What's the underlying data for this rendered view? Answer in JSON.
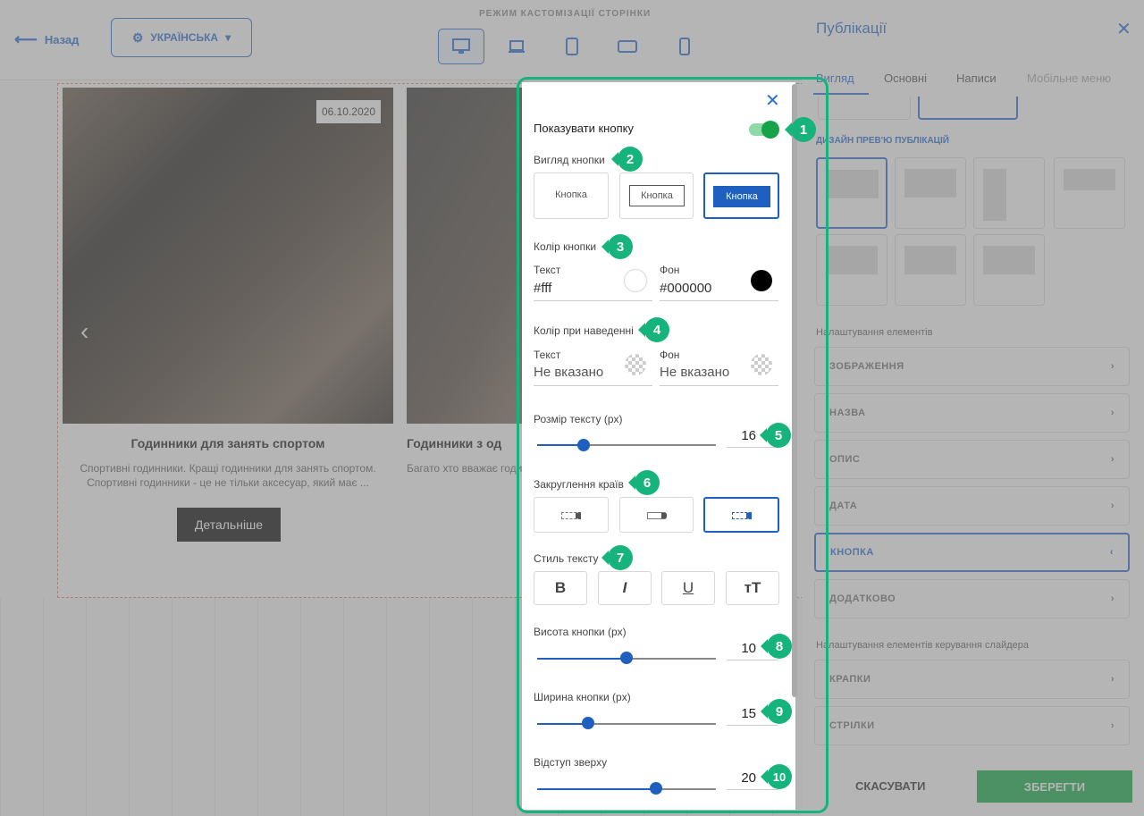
{
  "builder": {
    "back_label": "Назад",
    "language": "УКРАЇНСЬКА",
    "mode_label": "РЕЖИМ КАСТОМІЗАЦІЇ СТОРІНКИ",
    "devices": [
      "desktop-icon",
      "laptop-icon",
      "tablet-icon",
      "tablet-landscape-icon",
      "mobile-icon"
    ],
    "cards": [
      {
        "date": "06.10.2020",
        "title": "Годинники для занять спортом",
        "desc": "Спортивні годинники. Кращі годинники для занять спортом. Спортивні годинники - це не тільки аксесуар, який має ...",
        "button": "Детальніше"
      },
      {
        "title": "Годинники з од",
        "desc": "Багато хто вважає годинники ... і нетрадиційними, як ..."
      }
    ]
  },
  "right_panel": {
    "title": "Публікації",
    "tabs": [
      "Вигляд",
      "Основні",
      "Написи",
      "Мобільне меню"
    ],
    "design_label": "ДИЗАЙН ПРЕВ'Ю ПУБЛІКАЦІЙ",
    "elements_label": "Налаштування елементів",
    "elements": [
      "ЗОБРАЖЕННЯ",
      "НАЗВА",
      "ОПИС",
      "ДАТА",
      "КНОПКА",
      "ДОДАТКОВО"
    ],
    "slider_label": "Налаштування елементів керування слайдера",
    "slider_items": [
      "КРАПКИ",
      "СТРІЛКИ"
    ],
    "cancel": "СКАСУВАТИ",
    "save": "ЗБЕРЕГТИ"
  },
  "popup": {
    "show_button": "Показувати кнопку",
    "show_button_on": true,
    "style_label": "Вигляд кнопки",
    "style_options": [
      "Кнопка",
      "Кнопка",
      "Кнопка"
    ],
    "color_label": "Колір кнопки",
    "text_label": "Текст",
    "bg_label": "Фон",
    "text_color": "#fff",
    "bg_color": "#000000",
    "hover_label": "Колір при наведенні",
    "hover_text": "Не вказано",
    "hover_bg": "Не вказано",
    "font_size_label": "Розмір тексту (px)",
    "font_size": "16",
    "radius_label": "Закруглення країв",
    "text_style_label": "Стиль тексту",
    "text_style_buttons": [
      "B",
      "I",
      "U",
      "тT"
    ],
    "height_label": "Висота кнопки (px)",
    "height": "10",
    "width_label": "Ширина кнопки (px)",
    "width": "15",
    "top_label": "Відступ зверху",
    "top": "20"
  },
  "badges": [
    "1",
    "2",
    "3",
    "4",
    "5",
    "6",
    "7",
    "8",
    "9",
    "10"
  ],
  "colors": {
    "accent": "#1f5fbf",
    "highlight": "#17b37d",
    "save": "#17b04a"
  }
}
